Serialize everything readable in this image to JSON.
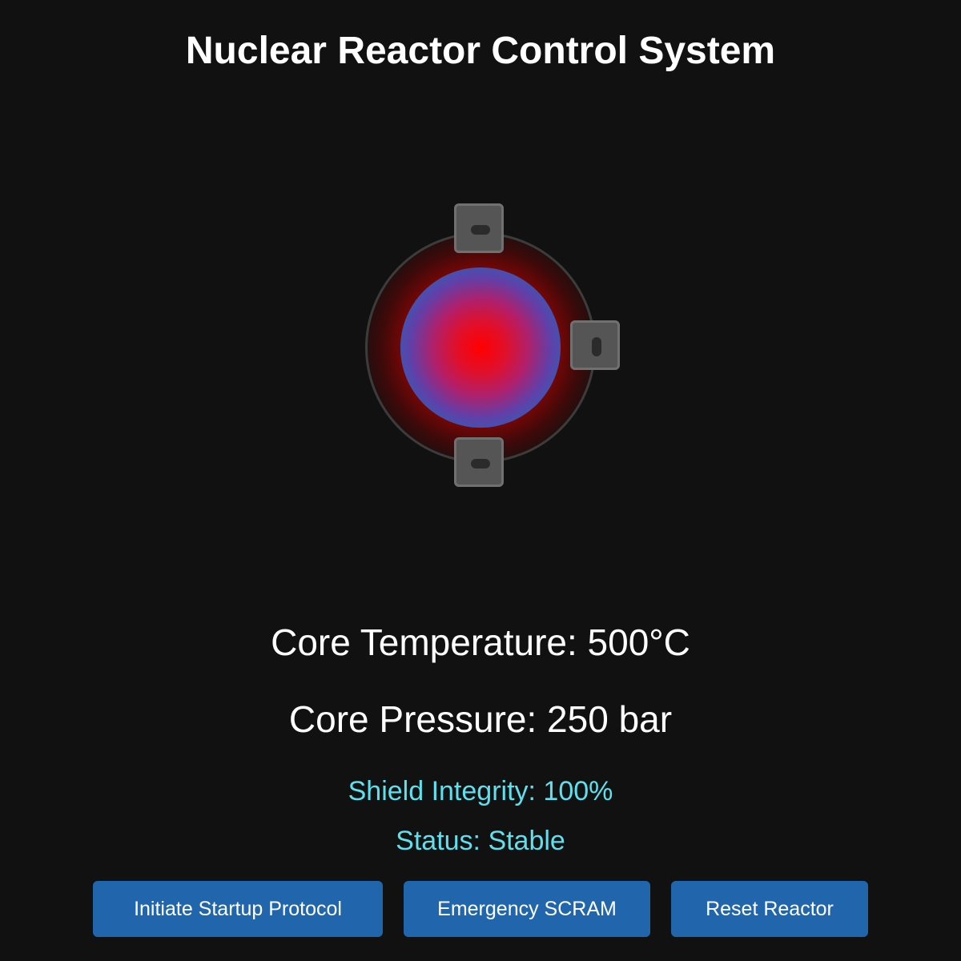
{
  "header": {
    "title": "Nuclear Reactor Control System"
  },
  "reactor": {
    "control_rods": [
      {
        "name": "control-rod-top",
        "icon": "slot-horizontal"
      },
      {
        "name": "control-rod-right",
        "icon": "slot-vertical"
      },
      {
        "name": "control-rod-bottom",
        "icon": "slot-horizontal"
      }
    ],
    "core_colors": {
      "hot_center": "#ff0000",
      "outer": "#1f6bc0",
      "ring": "#3c3c3c"
    }
  },
  "readouts": {
    "temperature": "Core Temperature: 500°C",
    "pressure": "Core Pressure: 250 bar",
    "shield": "Shield Integrity: 100%",
    "status": "Status: Stable"
  },
  "controls": {
    "startup_label": "Initiate Startup Protocol",
    "scram_label": "Emergency SCRAM",
    "reset_label": "Reset Reactor"
  },
  "colors": {
    "background": "#111111",
    "button": "#2166ad",
    "accent_text": "#5ee0ee",
    "rod": "#555555"
  }
}
